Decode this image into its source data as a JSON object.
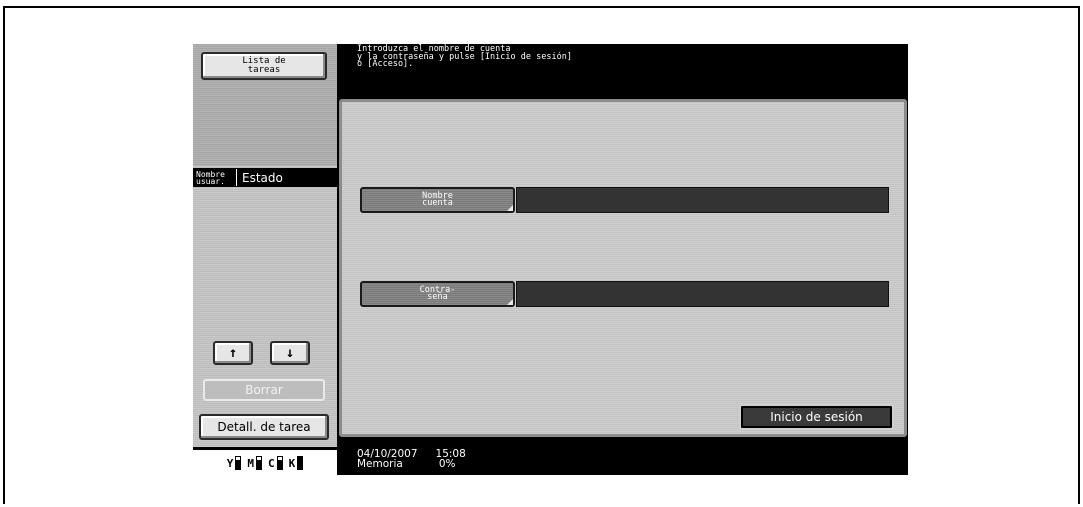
{
  "message": {
    "line1": "Introduzca el nombre de cuenta",
    "line2": "y la contraseña y pulse [Inicio de sesión]",
    "line3": "o [Acceso]."
  },
  "left_panel": {
    "job_list_line1": "Lista de",
    "job_list_line2": "tareas",
    "col_user_line1": "Nombre",
    "col_user_line2": "usuar.",
    "col_status": "Estado",
    "up_icon": "↑",
    "down_icon": "↓",
    "delete_label": "Borrar",
    "job_detail_label": "Detall. de tarea"
  },
  "form": {
    "account_label_line1": "Nombre",
    "account_label_line2": "cuenta",
    "account_value": "",
    "password_label_line1": "Contra-",
    "password_label_line2": "seña",
    "password_value": "",
    "login_label": "Inicio de sesión"
  },
  "status_bar": {
    "date": "04/10/2007",
    "time": "15:08",
    "memory_label": "Memoria",
    "memory_value": "0%"
  },
  "toner": [
    {
      "letter": "Y",
      "level": 0.7
    },
    {
      "letter": "M",
      "level": 0.7
    },
    {
      "letter": "C",
      "level": 0.7
    },
    {
      "letter": "K",
      "level": 1.0
    }
  ]
}
